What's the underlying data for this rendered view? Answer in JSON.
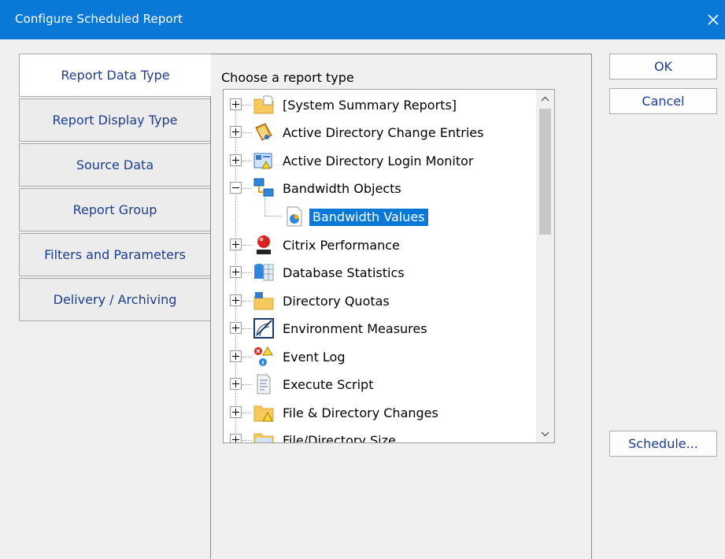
{
  "window": {
    "title": "Configure Scheduled Report",
    "close_icon": "close-icon"
  },
  "tabs": [
    {
      "label": "Report Data Type",
      "active": true
    },
    {
      "label": "Report Display Type",
      "active": false
    },
    {
      "label": "Source Data",
      "active": false
    },
    {
      "label": "Report Group",
      "active": false
    },
    {
      "label": "Filters and Parameters",
      "active": false
    },
    {
      "label": "Delivery / Archiving",
      "active": false
    }
  ],
  "panel": {
    "label": "Choose a report type"
  },
  "tree": {
    "items": [
      {
        "label": "[System Summary Reports]",
        "icon": "folder-icon",
        "expanded": false
      },
      {
        "label": "Active Directory Change Entries",
        "icon": "ad-change-book-icon",
        "expanded": false
      },
      {
        "label": "Active Directory Login Monitor",
        "icon": "ad-login-monitor-icon",
        "expanded": false
      },
      {
        "label": "Bandwidth Objects",
        "icon": "network-computers-icon",
        "expanded": true
      },
      {
        "label": "Bandwidth Values",
        "icon": "pie-chart-document-icon",
        "selected": true,
        "child": true
      },
      {
        "label": "Citrix Performance",
        "icon": "citrix-red-ball-icon",
        "expanded": false
      },
      {
        "label": "Database Statistics",
        "icon": "database-table-icon",
        "expanded": false
      },
      {
        "label": "Directory Quotas",
        "icon": "folder-chart-icon",
        "expanded": false
      },
      {
        "label": "Environment Measures",
        "icon": "environment-gauge-icon",
        "expanded": false
      },
      {
        "label": "Event Log",
        "icon": "event-log-icon",
        "expanded": false
      },
      {
        "label": "Execute Script",
        "icon": "script-document-icon",
        "expanded": false
      },
      {
        "label": "File & Directory Changes",
        "icon": "folder-warning-icon",
        "expanded": false
      },
      {
        "label": "File/Directory Size",
        "icon": "folder-size-icon",
        "expanded": false
      }
    ]
  },
  "buttons": {
    "ok": "OK",
    "cancel": "Cancel",
    "schedule": "Schedule..."
  },
  "colors": {
    "titlebar": "#0a78d7",
    "selection": "#0a78d7",
    "tab_text": "#1b3e8f"
  }
}
